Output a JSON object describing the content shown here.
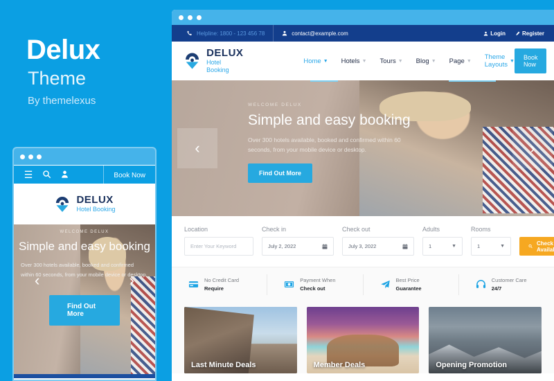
{
  "promo": {
    "title": "Delux",
    "subtitle": "Theme",
    "author": "By themelexus"
  },
  "brand": {
    "accent": "#26a9e0",
    "dark_blue": "#133e8c",
    "orange": "#f6a821",
    "name": "DELUX",
    "tagline": "Hotel Booking"
  },
  "topbar": {
    "helpline": "Helpline: 1800 - 123 456 78",
    "email": "contact@example.com",
    "login": "Login",
    "register": "Register"
  },
  "nav": {
    "items": [
      {
        "label": "Home",
        "active": true,
        "caret": true
      },
      {
        "label": "Hotels",
        "active": false,
        "caret": true
      },
      {
        "label": "Tours",
        "active": false,
        "caret": true
      },
      {
        "label": "Blog",
        "active": false,
        "caret": true
      },
      {
        "label": "Page",
        "active": false,
        "caret": true
      },
      {
        "label": "Theme Layouts",
        "active": false,
        "caret": true
      }
    ],
    "book_now": "Book Now"
  },
  "hero": {
    "welcome": "WELCOME DELUX",
    "heading": "Simple and easy booking",
    "description": "Over 300 hotels available, booked and confirmed within 60 seconds, from your mobile device or desktop.",
    "button": "Find Out More",
    "prev_arrow": "‹",
    "next_arrow": "›"
  },
  "booking": {
    "location_label": "Location",
    "location_placeholder": "Enter Your Keyword",
    "checkin_label": "Check in",
    "checkin_value": "July 2, 2022",
    "checkout_label": "Check out",
    "checkout_value": "July 3, 2022",
    "adults_label": "Adults",
    "adults_value": "1",
    "rooms_label": "Rooms",
    "rooms_value": "1",
    "submit": "Check Availability"
  },
  "features": [
    {
      "icon": "credit-card-icon",
      "line1": "No Credit Card",
      "line2": "Require"
    },
    {
      "icon": "money-icon",
      "line1": "Payment When",
      "line2": "Check out"
    },
    {
      "icon": "paper-plane-icon",
      "line1": "Best Price",
      "line2": "Guarantee"
    },
    {
      "icon": "headphones-icon",
      "line1": "Customer Care",
      "line2": "24/7"
    }
  ],
  "deals": [
    {
      "title": "Last Minute Deals"
    },
    {
      "title": "Member Deals"
    },
    {
      "title": "Opening Promotion"
    }
  ],
  "mobile": {
    "book_now": "Book Now",
    "brand": "DELUX",
    "tagline": "Hotel Booking",
    "hero_welcome": "WELCOME DELUX",
    "hero_heading": "Simple and easy booking",
    "hero_description": "Over 300 hotels available, booked and confirmed within 60 seconds, from your mobile device or desktop.",
    "hero_button": "Find Out More"
  }
}
